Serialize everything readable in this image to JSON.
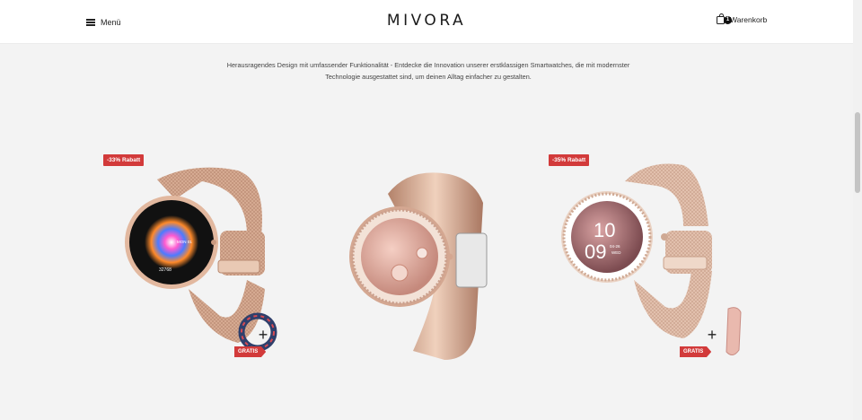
{
  "header": {
    "menu_label": "Menü",
    "logo_text": "MIVORA",
    "cart_label": "Warenkorb",
    "cart_count": "1"
  },
  "intro": {
    "line1": "Herausragendes Design mit umfassender Funktionalität - Entdecke die Innovation unserer erstklassigen Smartwatches, die mit modernster",
    "line2": "Technologie ausgestattet sind, um deinen Alltag einfacher zu gestalten."
  },
  "products": [
    {
      "discount_badge": "-33% Rabatt",
      "gratis_label": "GRATIS",
      "watch_face": {
        "date": "MON 01",
        "steps": "32768"
      }
    },
    {
      "watch_face": {}
    },
    {
      "discount_badge": "-35% Rabatt",
      "gratis_label": "GRATIS",
      "watch_face": {
        "hour": "10",
        "minute": "09",
        "date": "04-26",
        "day": "WED"
      }
    }
  ],
  "colors": {
    "accent_red": "#d23a3a",
    "rose_gold": "#d9ab8f",
    "background": "#f3f3f3"
  }
}
